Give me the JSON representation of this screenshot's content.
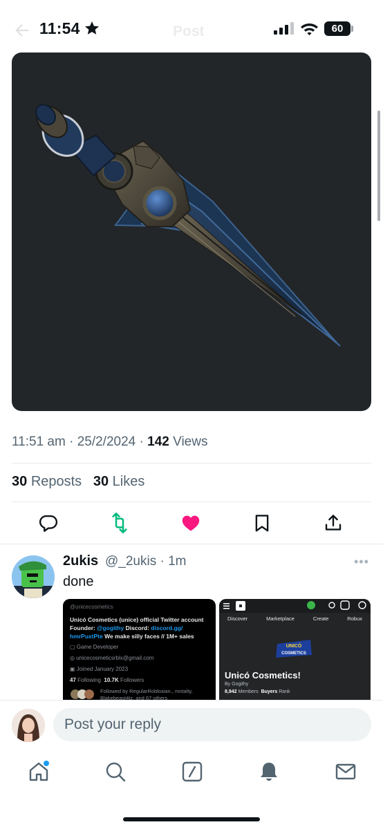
{
  "status_bar": {
    "time": "11:54",
    "battery": "60",
    "header_title": "Post"
  },
  "tweet": {
    "media_alt": "Dark blue dagger render",
    "meta": {
      "time": "11:51 am",
      "date": "25/2/2024",
      "views_count": "142",
      "views_label": "Views"
    },
    "stats": {
      "reposts_count": "30",
      "reposts_label": "Reposts",
      "likes_count": "30",
      "likes_label": "Likes"
    },
    "colors": {
      "repost_green": "#00ba7c",
      "like_pink": "#f91880"
    }
  },
  "reply": {
    "display_name": "2ukis",
    "handle": "@_2ukis",
    "time_ago": "1m",
    "text": "done",
    "screenshot_left": {
      "handle": "@unicecosmetics",
      "bio_line1": "Unicó Cosmetics (unice) official Twitter account",
      "bio_founder": "Founder:",
      "bio_founder_link": "@gogithy",
      "bio_discord": "Discord:",
      "bio_discord_link": "discord.gg/ hmrPuxtPte",
      "bio_tail": "We make silly faces // 1M+ sales",
      "category": "Game Developer",
      "email": "unicecosmeticsrblx@gmail.com",
      "joined": "Joined January 2023",
      "following_count": "47",
      "following_label": "Following",
      "followers_count": "10.7K",
      "followers_label": "Followers",
      "mutuals": "Followed by RegularRobloxian., mntalty, Blakebeast4tz, and 67 others"
    },
    "screenshot_right": {
      "tabs": [
        "Discover",
        "Marketplace",
        "Create",
        "Robux"
      ],
      "group_name": "Unicó Cosmetics!",
      "by_label": "By",
      "by_name": "Gogithy",
      "members_count": "8,942",
      "members_label": "Members",
      "rank": "Buyers",
      "rank_label": "Rank",
      "logo_text": "UNICÓ COSMETICS"
    }
  },
  "composer": {
    "placeholder": "Post your reply"
  },
  "tabbar": {
    "items": [
      "home-icon",
      "search-icon",
      "grok-icon",
      "notifications-icon",
      "messages-icon"
    ]
  }
}
